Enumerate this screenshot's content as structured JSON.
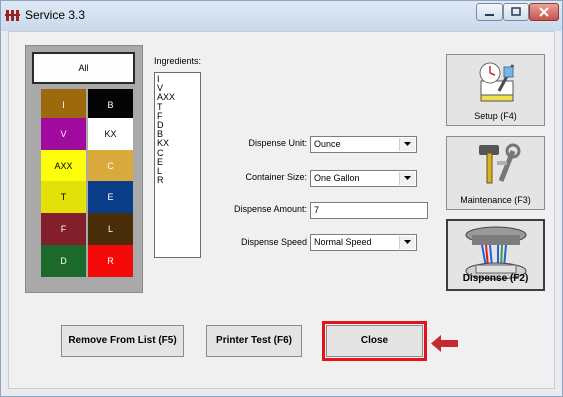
{
  "window": {
    "title": "Service 3.3",
    "colors": {
      "titlebar": "#c9d9ec",
      "close": "#c75050",
      "highlight": "#e1141b",
      "arrow": "#c8282f"
    }
  },
  "swatches": {
    "all_label": "All",
    "items": [
      {
        "label": "I",
        "bg": "#9c6a0c",
        "fg": "#ffffff"
      },
      {
        "label": "B",
        "bg": "#050505",
        "fg": "#ffffff"
      },
      {
        "label": "V",
        "bg": "#a10a9e",
        "fg": "#ffffff"
      },
      {
        "label": "KX",
        "bg": "#ffffff",
        "fg": "#000000"
      },
      {
        "label": "AXX",
        "bg": "#fdfd0c",
        "fg": "#000000"
      },
      {
        "label": "C",
        "bg": "#d9a93c",
        "fg": "#ffffff"
      },
      {
        "label": "T",
        "bg": "#e2e20a",
        "fg": "#000000"
      },
      {
        "label": "E",
        "bg": "#0a3d87",
        "fg": "#ffffff"
      },
      {
        "label": "F",
        "bg": "#821f2a",
        "fg": "#ffffff"
      },
      {
        "label": "L",
        "bg": "#4a2d09",
        "fg": "#ffffff"
      },
      {
        "label": "D",
        "bg": "#1b6a2c",
        "fg": "#ffffff"
      },
      {
        "label": "R",
        "bg": "#f50a0a",
        "fg": "#ffffff"
      }
    ]
  },
  "ingredients": {
    "label": "Ingredients:",
    "items": [
      "I",
      "V",
      "AXX",
      "T",
      "F",
      "D",
      "B",
      "KX",
      "C",
      "E",
      "L",
      "R"
    ]
  },
  "form": {
    "dispense_unit": {
      "label": "Dispense Unit:",
      "value": "Ounce"
    },
    "container_size": {
      "label": "Container Size:",
      "value": "One Gallon"
    },
    "dispense_amount": {
      "label": "Dispense Amount:",
      "value": "7"
    },
    "dispense_speed": {
      "label": "Dispense Speed",
      "value": "Normal Speed"
    }
  },
  "side_buttons": {
    "setup": "Setup (F4)",
    "maintenance": "Maintenance (F3)",
    "dispense": "Dispense (F2)"
  },
  "bottom_buttons": {
    "remove": "Remove From List (F5)",
    "printer_test": "Printer Test (F6)",
    "close": "Close"
  },
  "icons": {
    "app": "app-icon",
    "minimize": "minimize-icon",
    "maximize": "maximize-icon",
    "close": "close-icon",
    "setup": "setup-icon",
    "maintenance": "tools-icon",
    "dispense": "dispenser-icon",
    "annotation": "arrow-left-icon"
  }
}
